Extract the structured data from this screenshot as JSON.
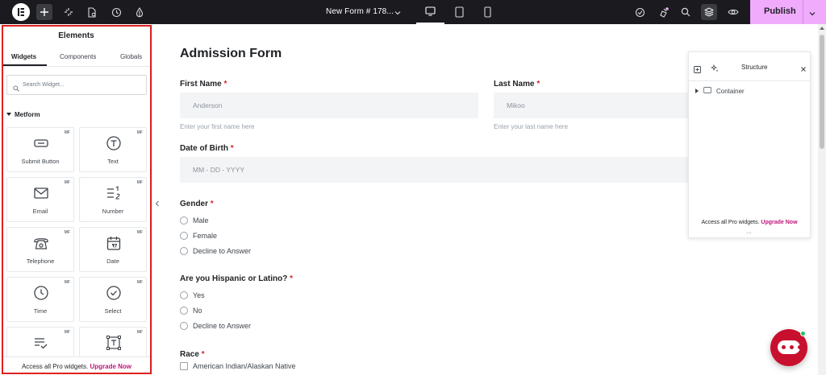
{
  "topbar": {
    "document_title": "New Form # 178...",
    "publish_label": "Publish",
    "colors": {
      "bar": "#1b1b1f",
      "publish": "#f0abfc"
    },
    "icons": [
      "elementor-logo-icon",
      "add-icon",
      "site-settings-icon",
      "page-settings-icon",
      "history-icon",
      "theme-style-icon",
      "desktop-icon",
      "tablet-icon",
      "mobile-icon",
      "finder-icon",
      "notifications-icon",
      "search-icon",
      "structure-icon",
      "preview-icon",
      "chevron-down-icon"
    ]
  },
  "panel": {
    "title": "Elements",
    "tabs": [
      "Widgets",
      "Components",
      "Globals"
    ],
    "active_tab": "Widgets",
    "search_placeholder": "Search Widget...",
    "category": "Metform",
    "badge": "MF",
    "widgets": [
      {
        "label": "Submit Button",
        "icon": "submit-button-icon"
      },
      {
        "label": "Text",
        "icon": "text-icon"
      },
      {
        "label": "Email",
        "icon": "email-icon"
      },
      {
        "label": "Number",
        "icon": "number-icon"
      },
      {
        "label": "Telephone",
        "icon": "telephone-icon"
      },
      {
        "label": "Date",
        "icon": "date-icon"
      },
      {
        "label": "Time",
        "icon": "time-icon"
      },
      {
        "label": "Select",
        "icon": "select-icon"
      },
      {
        "label": "",
        "icon": "checklist-icon"
      },
      {
        "label": "",
        "icon": "text-frame-icon"
      }
    ],
    "promo_text": "Access all Pro widgets.",
    "promo_link": "Upgrade Now",
    "highlight_color": "#e02020"
  },
  "form": {
    "title": "Admission Form",
    "first_name": {
      "label": "First Name",
      "value": "Anderson",
      "help": "Enter your first name here"
    },
    "last_name": {
      "label": "Last Name",
      "value": "Mikoo",
      "help": "Enter your last name here"
    },
    "dob": {
      "label": "Date of Birth",
      "placeholder": "MM - DD - YYYY"
    },
    "gender": {
      "label": "Gender",
      "options": [
        "Male",
        "Female",
        "Decline to Answer"
      ]
    },
    "hispanic": {
      "label": "Are you Hispanic or Latino?",
      "options": [
        "Yes",
        "No",
        "Decline to Answer"
      ]
    },
    "race": {
      "label": "Race",
      "options": [
        "American Indian/Alaskan Native"
      ]
    },
    "required_marker": "*"
  },
  "structure": {
    "title": "Structure",
    "items": [
      "Container"
    ],
    "promo_text": "Access all Pro widgets.",
    "promo_link": "Upgrade Now",
    "more": "..."
  }
}
